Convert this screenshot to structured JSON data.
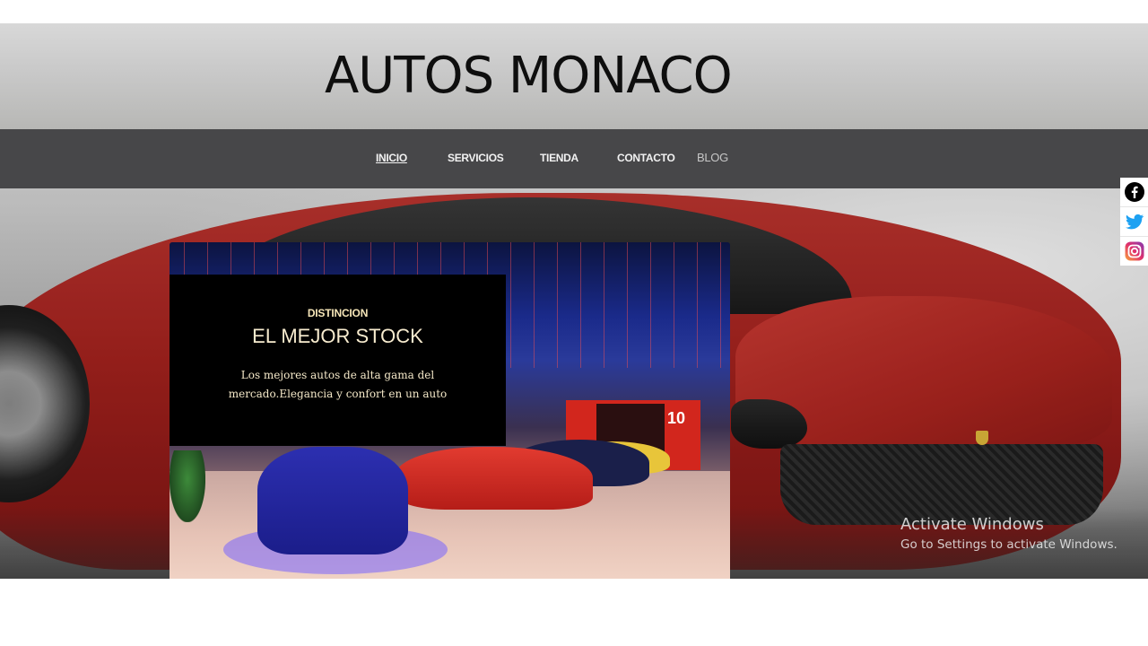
{
  "header": {
    "title": "AUTOS MONACO"
  },
  "nav": {
    "items": [
      {
        "label": "INICIO",
        "active": true
      },
      {
        "label": "SERVICIOS"
      },
      {
        "label": "TIENDA"
      },
      {
        "label": "CONTACTO"
      },
      {
        "label": "BLOG"
      }
    ]
  },
  "hero": {
    "eyebrow": "DISTINCION",
    "heading": "EL MEJOR STOCK",
    "text": "Los mejores autos de alta gama del mercado.Elegancia y confort en un auto",
    "showroom_sign": "10"
  },
  "social": {
    "items": [
      {
        "icon": "facebook-icon",
        "color": "#000000"
      },
      {
        "icon": "twitter-icon",
        "color": "#1da1f2"
      },
      {
        "icon": "instagram-icon",
        "color": "#e1306c"
      }
    ]
  },
  "watermark": {
    "line1": "Activate Windows",
    "line2": "Go to Settings to activate Windows."
  },
  "colors": {
    "navbar": "#474749",
    "info_box": "#000000",
    "accent_text": "#f6e6b8"
  }
}
